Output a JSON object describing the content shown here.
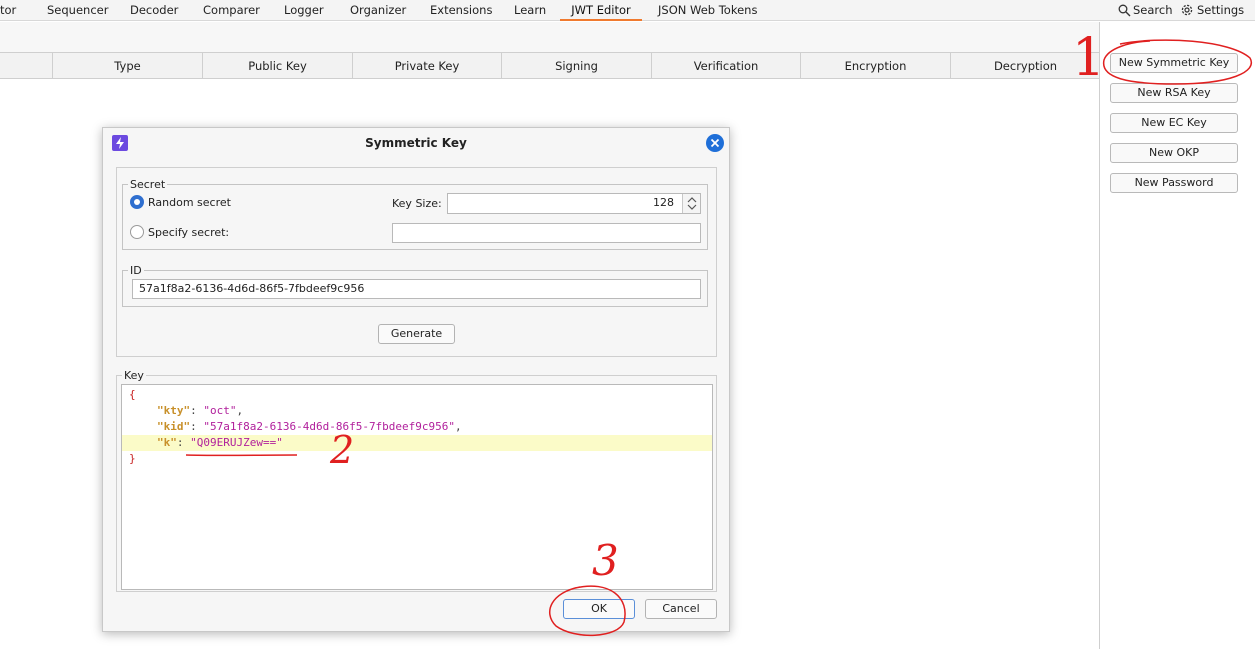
{
  "tabs": [
    {
      "label": "tor",
      "active": false
    },
    {
      "label": "Sequencer",
      "active": false
    },
    {
      "label": "Decoder",
      "active": false
    },
    {
      "label": "Comparer",
      "active": false
    },
    {
      "label": "Logger",
      "active": false
    },
    {
      "label": "Organizer",
      "active": false
    },
    {
      "label": "Extensions",
      "active": false
    },
    {
      "label": "Learn",
      "active": false
    },
    {
      "label": "JWT Editor",
      "active": true
    },
    {
      "label": "JSON Web Tokens",
      "active": false
    }
  ],
  "topright": {
    "search_label": "Search",
    "settings_label": "Settings"
  },
  "table": {
    "columns": [
      "Type",
      "Public Key",
      "Private Key",
      "Signing",
      "Verification",
      "Encryption",
      "Decryption"
    ]
  },
  "right_buttons": [
    "New Symmetric Key",
    "New RSA Key",
    "New EC Key",
    "New OKP",
    "New Password"
  ],
  "dialog": {
    "title": "Symmetric Key",
    "secret_group": "Secret",
    "random_secret": "Random secret",
    "specify_secret": "Specify secret:",
    "random_selected": true,
    "key_size_label": "Key Size:",
    "key_size_value": "128",
    "specify_value": "",
    "id_group": "ID",
    "id_value": "57a1f8a2-6136-4d6d-86f5-7fbdeef9c956",
    "generate_label": "Generate",
    "key_group": "Key",
    "json": {
      "open": "{",
      "kty_key": "\"kty\"",
      "kty_val": "\"oct\"",
      "kid_key": "\"kid\"",
      "kid_val": "\"57a1f8a2-6136-4d6d-86f5-7fbdeef9c956\"",
      "k_key": "\"k\"",
      "k_val": "\"Q09ERUJZew==\"",
      "close": "}"
    },
    "ok_label": "OK",
    "cancel_label": "Cancel"
  },
  "annotations": {
    "one": "1",
    "two": "2",
    "three": "3"
  },
  "colors": {
    "accent": "#f07a2e",
    "annotation": "#e02020",
    "selection": "#2f6fcf"
  }
}
